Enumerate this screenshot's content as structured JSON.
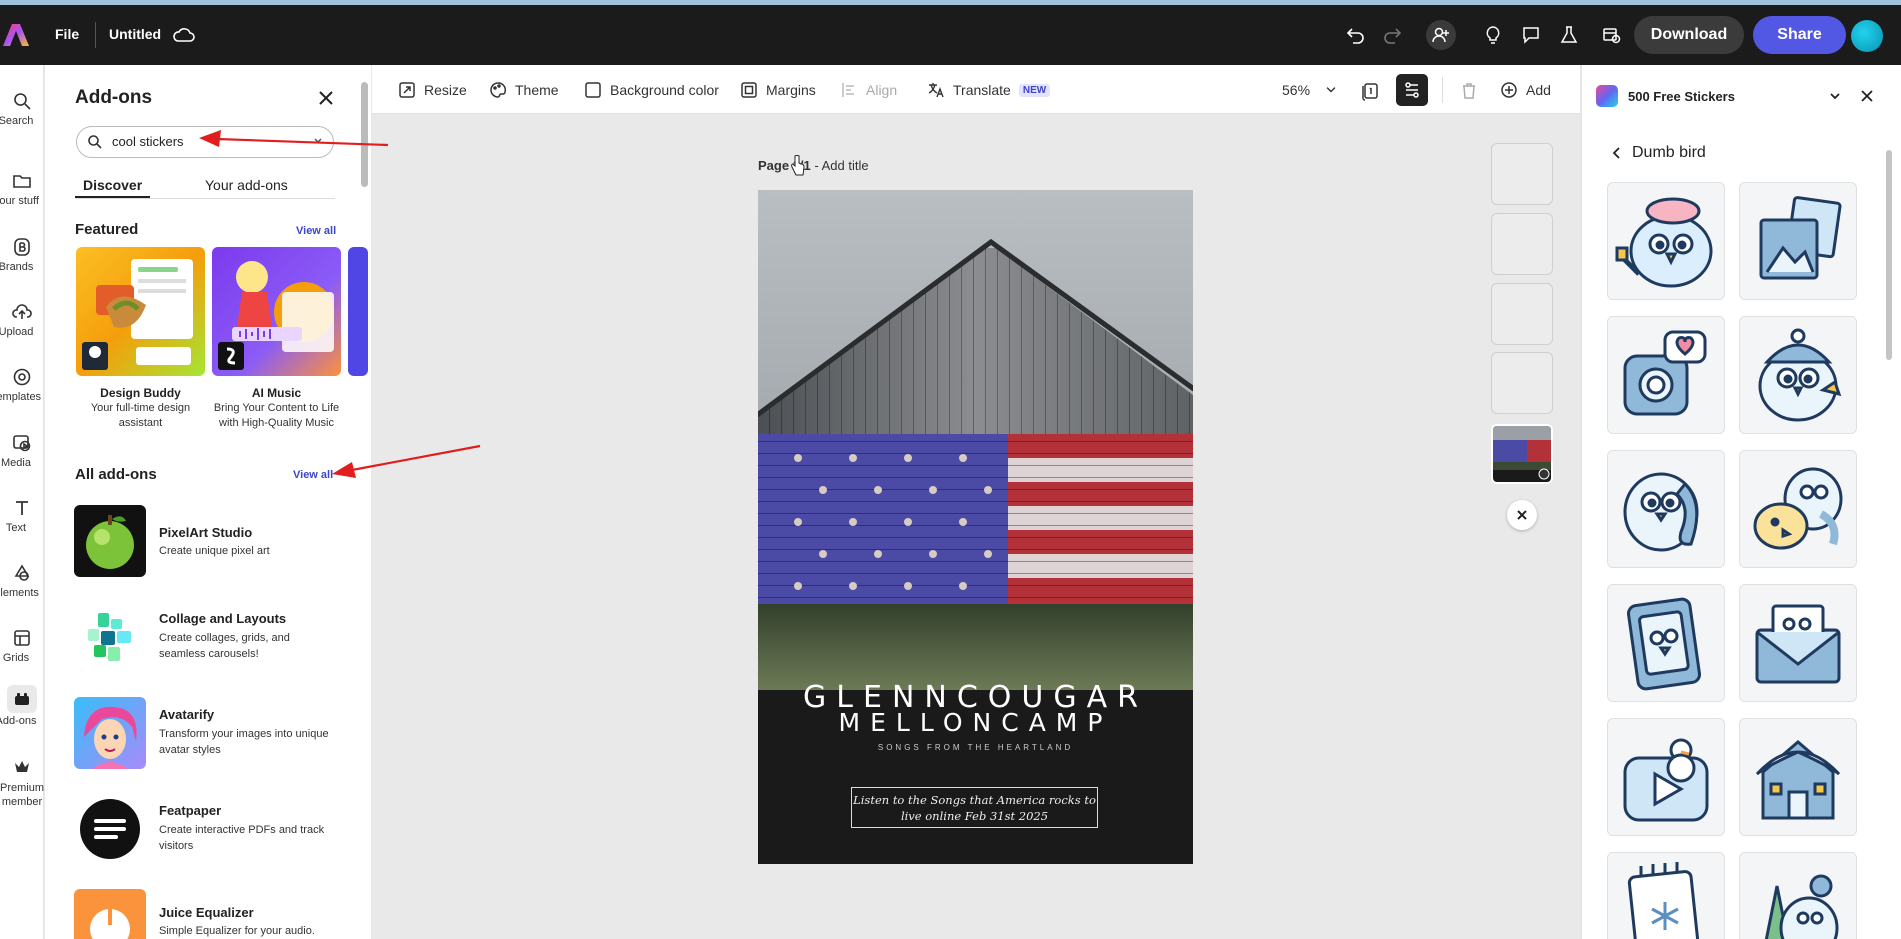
{
  "header": {
    "file_label": "File",
    "doc_title": "Untitled",
    "download_label": "Download",
    "share_label": "Share"
  },
  "rail": {
    "items": [
      {
        "label": "Search",
        "icon": "search-icon"
      },
      {
        "label": "Your stuff",
        "icon": "folder-icon"
      },
      {
        "label": "Brands",
        "icon": "brand-icon"
      },
      {
        "label": "Upload",
        "icon": "upload-icon"
      },
      {
        "label": "Templates",
        "icon": "templates-icon"
      },
      {
        "label": "Media",
        "icon": "media-icon"
      },
      {
        "label": "Text",
        "icon": "text-icon"
      },
      {
        "label": "Elements",
        "icon": "elements-icon"
      },
      {
        "label": "Grids",
        "icon": "grids-icon"
      },
      {
        "label": "Add-ons",
        "icon": "addons-icon"
      },
      {
        "label": "Premium member",
        "icon": "crown-icon"
      }
    ]
  },
  "addons_panel": {
    "title": "Add-ons",
    "search_value": "cool stickers",
    "tabs": [
      "Discover",
      "Your add-ons"
    ],
    "featured_title": "Featured",
    "view_all": "View all",
    "featured": [
      {
        "name": "Design Buddy",
        "desc_1": "Your full-time design",
        "desc_2": "assistant"
      },
      {
        "name": "AI Music",
        "desc_1": "Bring Your Content to Life",
        "desc_2": "with High-Quality Music"
      }
    ],
    "all_title": "All add-ons",
    "all_view_all": "View all",
    "addons": [
      {
        "name": "PixelArt Studio",
        "desc": "Create unique pixel art"
      },
      {
        "name": "Collage and Layouts",
        "desc": "Create collages, grids, and seamless carousels!"
      },
      {
        "name": "Avatarify",
        "desc": "Transform your images into unique avatar styles"
      },
      {
        "name": "Featpaper",
        "desc": "Create interactive PDFs and track visitors"
      },
      {
        "name": "Juice Equalizer",
        "desc": "Simple Equalizer for your audio."
      }
    ]
  },
  "toolbar": {
    "resize": "Resize",
    "theme": "Theme",
    "background_color": "Background color",
    "margins": "Margins",
    "align": "Align",
    "translate": "Translate",
    "new_badge": "NEW",
    "zoom": "56%",
    "add": "Add"
  },
  "canvas": {
    "page_label": "Page 1/1",
    "page_title_hint": " - Add title",
    "poster": {
      "line1": "GLENNCOUGAR",
      "line2": "MELLONCAMP",
      "subtitle": "SONGS FROM THE HEARTLAND",
      "box_line1": "Listen to the Songs that America rocks to",
      "box_line2": "live online Feb 31st 2025"
    }
  },
  "right_panel": {
    "title": "500 Free Stickers",
    "back_label": "Dumb bird"
  },
  "colors": {
    "accent": "#5258e4",
    "header_bg": "#1b1b1b",
    "annotation_arrow": "#e11d1d"
  }
}
